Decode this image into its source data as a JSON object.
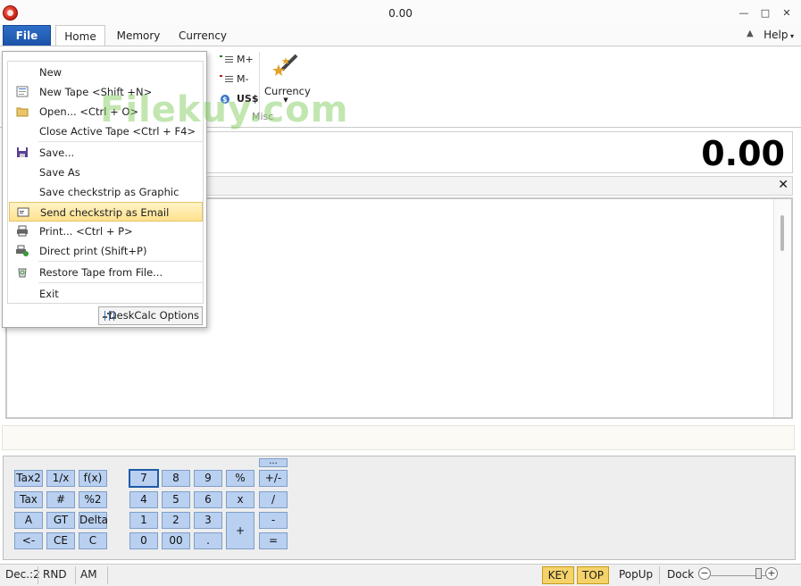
{
  "window": {
    "title": "0.00",
    "minimize": "—",
    "maximize": "□",
    "close": "✕"
  },
  "tabs": {
    "file": "File",
    "home": "Home",
    "memory": "Memory",
    "currency": "Currency",
    "help": "Help"
  },
  "ribbon": {
    "m_plus": "M+",
    "m_minus": "M-",
    "usd": "US$",
    "currency_btn": "Currency",
    "group_label": "Misc"
  },
  "display": {
    "value": "0.00"
  },
  "file_menu": {
    "items": [
      {
        "label": "New",
        "icon": "blank-icon"
      },
      {
        "label": "New Tape <Shift +N>",
        "icon": "new-tape-icon"
      },
      {
        "label": "Open... <Ctrl + O>",
        "icon": "folder-icon"
      },
      {
        "label": "Close Active Tape <Ctrl + F4>",
        "icon": "blank-icon"
      },
      {
        "label": "Save...",
        "icon": "save-icon"
      },
      {
        "label": "Save As",
        "icon": "blank-icon"
      },
      {
        "label": "Save checkstrip as Graphic",
        "icon": "blank-icon"
      },
      {
        "label": "Send checkstrip as Email",
        "icon": "email-icon"
      },
      {
        "label": "Print... <Ctrl + P>",
        "icon": "printer-icon"
      },
      {
        "label": "Direct print (Shift+P)",
        "icon": "direct-print-icon"
      },
      {
        "label": "Restore Tape from File...",
        "icon": "restore-icon"
      },
      {
        "label": "Exit",
        "icon": "blank-icon"
      }
    ],
    "highlighted_index": 7,
    "options_button": "DeskCalc Options"
  },
  "watermark": "Filekuy.com",
  "keypad": {
    "dots": "...",
    "rows": [
      [
        "Tax2",
        "1/x",
        "f(x)",
        "7",
        "8",
        "9",
        "%",
        "+/-"
      ],
      [
        "Tax",
        "#",
        "%2",
        "4",
        "5",
        "6",
        "x",
        "/"
      ],
      [
        "A",
        "GT",
        "Delta",
        "1",
        "2",
        "3",
        "+",
        "-"
      ],
      [
        "<-",
        "CE",
        "C",
        "0",
        "00",
        ".",
        "=",
        ""
      ]
    ]
  },
  "statusbar": {
    "dec": "Dec.:2",
    "rnd": "RND",
    "am": "AM",
    "key": "KEY",
    "top": "TOP",
    "popup": "PopUp",
    "dock": "Dock",
    "zoom_minus": "−",
    "zoom_plus": "+"
  },
  "colors": {
    "file_tab": "#1a53a8",
    "key_bg": "#b9d0f0",
    "highlight": "#ffe28e",
    "status_highlight": "#f5d36a"
  }
}
